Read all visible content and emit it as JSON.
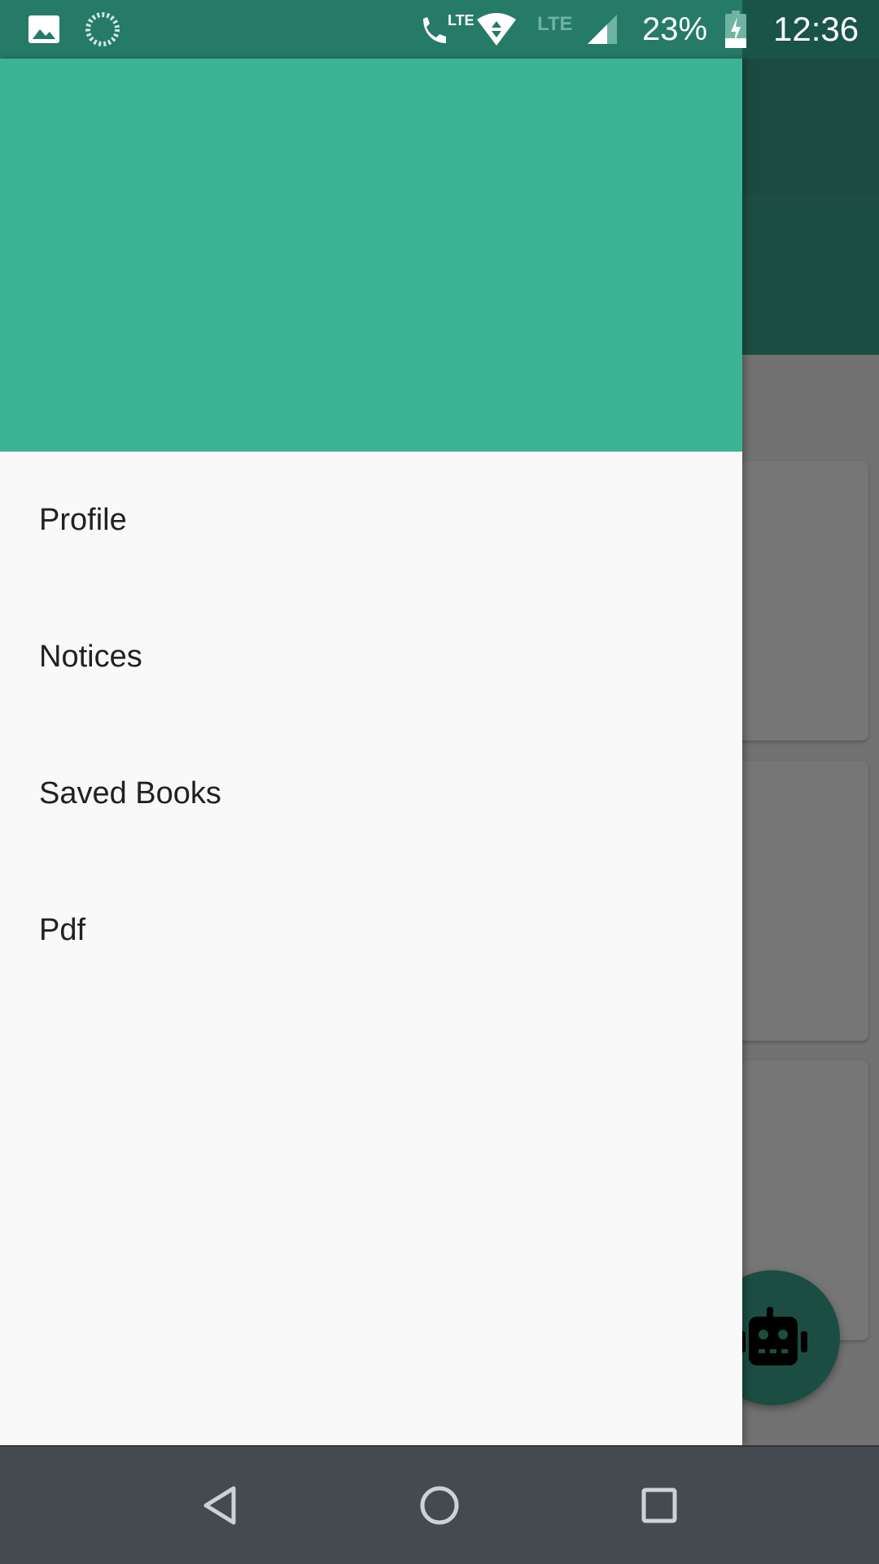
{
  "status_bar": {
    "battery_percent": "23%",
    "time": "12:36",
    "network_label_1": "LTE",
    "network_label_2": "LTE",
    "icons": [
      "image-notification-icon",
      "sync-spinner-icon",
      "volte-call-icon",
      "wifi-data-icon",
      "signal-icon",
      "battery-charging-icon"
    ]
  },
  "drawer": {
    "menu_items": [
      {
        "label": "Profile"
      },
      {
        "label": "Notices"
      },
      {
        "label": "Saved Books"
      },
      {
        "label": "Pdf"
      }
    ]
  },
  "fab": {
    "icon": "robot-icon"
  },
  "nav_bar": {
    "icons": [
      "back-icon",
      "home-icon",
      "recents-icon"
    ]
  },
  "colors": {
    "drawer_header": "#3cb394",
    "status_bar": "#267a68",
    "app_toolbar": "#1c4a40",
    "nav_bar": "#434a50"
  }
}
